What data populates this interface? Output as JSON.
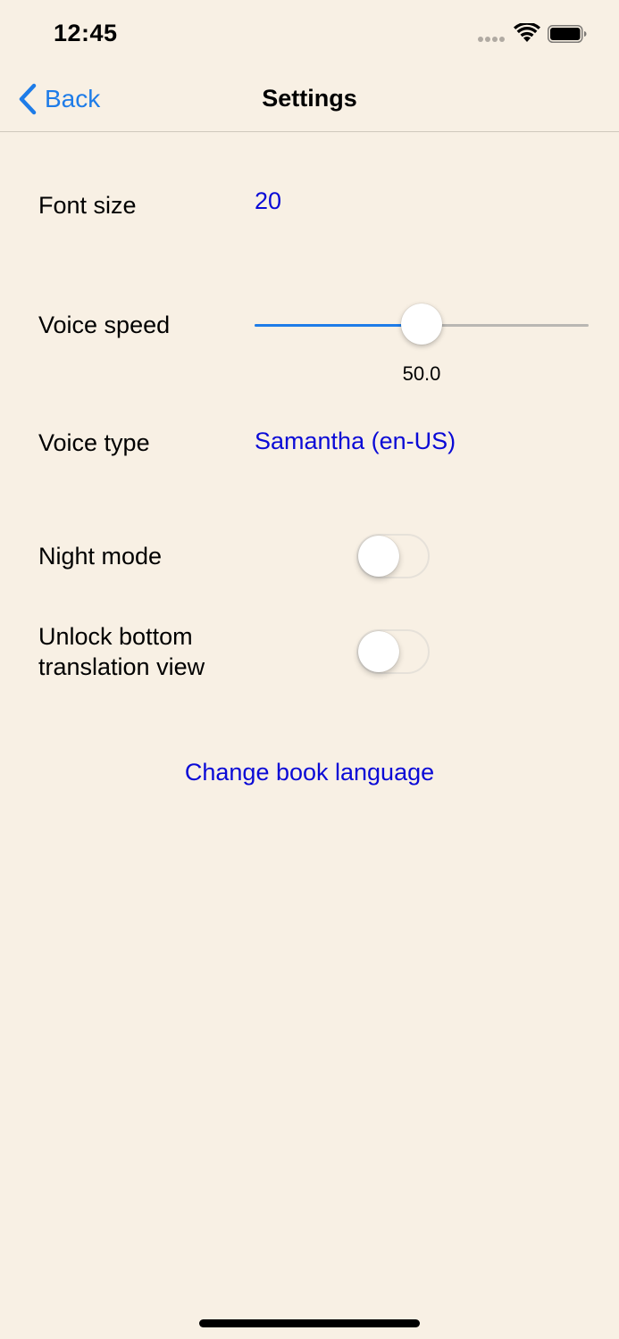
{
  "status_bar": {
    "time": "12:45",
    "signal_icon": "cellular-signal-icon",
    "wifi_icon": "wifi-icon",
    "battery_icon": "battery-icon"
  },
  "nav": {
    "back_label": "Back",
    "back_icon": "chevron-left-icon",
    "title": "Settings"
  },
  "settings": {
    "font_size": {
      "label": "Font size",
      "value": "20"
    },
    "voice_speed": {
      "label": "Voice speed",
      "value": 50,
      "min": 0,
      "max": 100,
      "value_text": "50.0"
    },
    "voice_type": {
      "label": "Voice type",
      "value": "Samantha (en-US)"
    },
    "night_mode": {
      "label": "Night mode",
      "enabled": false
    },
    "unlock_translation": {
      "label_line1": "Unlock bottom",
      "label_line2": "translation view",
      "enabled": false
    }
  },
  "change_language_label": "Change book language",
  "colors": {
    "background": "#f8f0e4",
    "accent_blue": "#1e7ce8",
    "link_blue": "#0a0ad6"
  }
}
